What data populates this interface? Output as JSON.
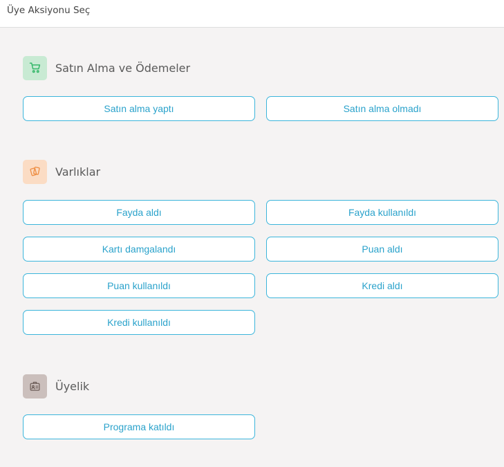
{
  "header": {
    "title": "Üye Aksiyonu Seç"
  },
  "colors": {
    "accent": "#2aa2cb",
    "button_border": "#3bb5db",
    "purchase_icon_bg": "#c8ead3",
    "purchase_icon": "#35b86a",
    "assets_icon_bg": "#fbdcc4",
    "assets_icon": "#ee8f45",
    "membership_icon_bg": "#cbbfbc",
    "membership_icon": "#6e5e59"
  },
  "sections": {
    "purchases": {
      "icon": "shopping-cart-icon",
      "title": "Satın Alma ve Ödemeler",
      "buttons": [
        "Satın alma yaptı",
        "Satın alma olmadı"
      ]
    },
    "assets": {
      "icon": "cards-icon",
      "title": "Varlıklar",
      "buttons": [
        "Fayda aldı",
        "Fayda kullanıldı",
        "Kartı damgalandı",
        "Puan aldı",
        "Puan kullanıldı",
        "Kredi aldı",
        "Kredi kullanıldı"
      ]
    },
    "membership": {
      "icon": "id-badge-icon",
      "title": "Üyelik",
      "buttons": [
        "Programa katıldı"
      ]
    }
  }
}
